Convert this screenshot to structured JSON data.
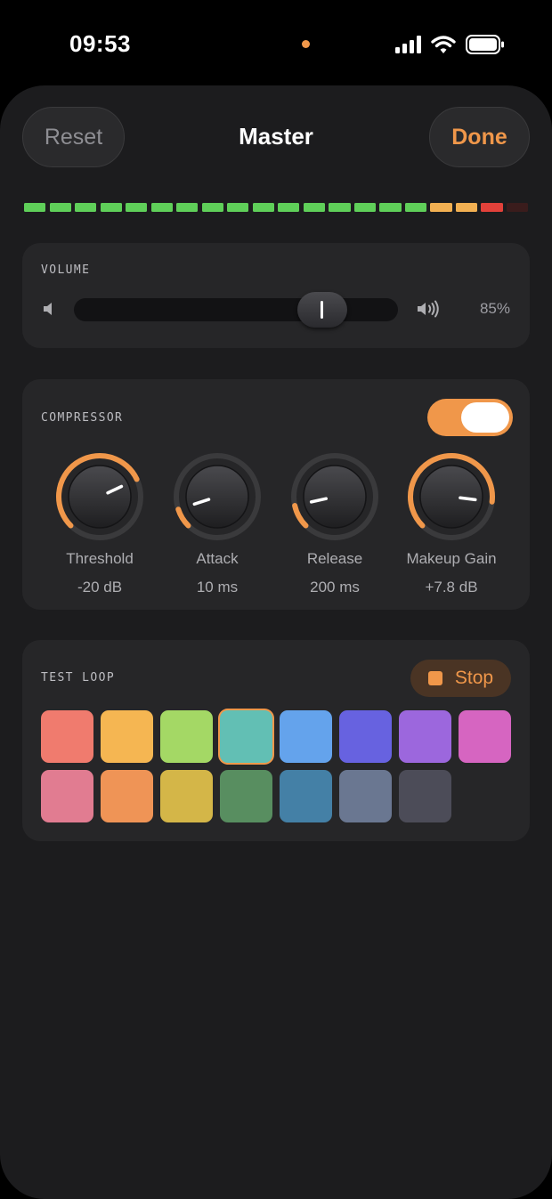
{
  "status": {
    "time": "09:53",
    "icons": [
      "privacy-dot-icon",
      "cellular-signal-icon",
      "wifi-icon",
      "battery-icon"
    ]
  },
  "header": {
    "reset_label": "Reset",
    "title": "Master",
    "done_label": "Done"
  },
  "meter": {
    "segments": 20,
    "lit_segments": 18,
    "green": 16,
    "amber": 2,
    "red": 1
  },
  "volume": {
    "label": "VOLUME",
    "level": 0.85,
    "value_text": "85%",
    "icons": [
      "speaker-low-icon",
      "speaker-high-icon"
    ]
  },
  "compressor": {
    "label": "COMPRESSOR",
    "enabled": true,
    "knobs": [
      {
        "name": "Threshold",
        "value": "-20 dB",
        "level": 0.74
      },
      {
        "name": "Attack",
        "value": "10 ms",
        "level": 0.1
      },
      {
        "name": "Release",
        "value": "200 ms",
        "level": 0.12
      },
      {
        "name": "Makeup Gain",
        "value": "+7.8 dB",
        "level": 0.86
      }
    ]
  },
  "test_loop": {
    "label": "TEST LOOP",
    "stop_label": "Stop",
    "selected_index": 3,
    "pads": [
      "#f07b6e",
      "#f5b652",
      "#a4d865",
      "#62bfb4",
      "#64a3ec",
      "#6762e0",
      "#9c67dd",
      "#d665c1",
      "#e17c91",
      "#ef9456",
      "#d4b648",
      "#588e60",
      "#4480a6",
      "#6a7791",
      "#4c4c58"
    ]
  },
  "colors": {
    "accent": "#f0974a",
    "meter_green": "#5fcf59",
    "meter_amber": "#f2b052",
    "meter_red": "#e2413a",
    "meter_off": "#3a1c1c"
  }
}
